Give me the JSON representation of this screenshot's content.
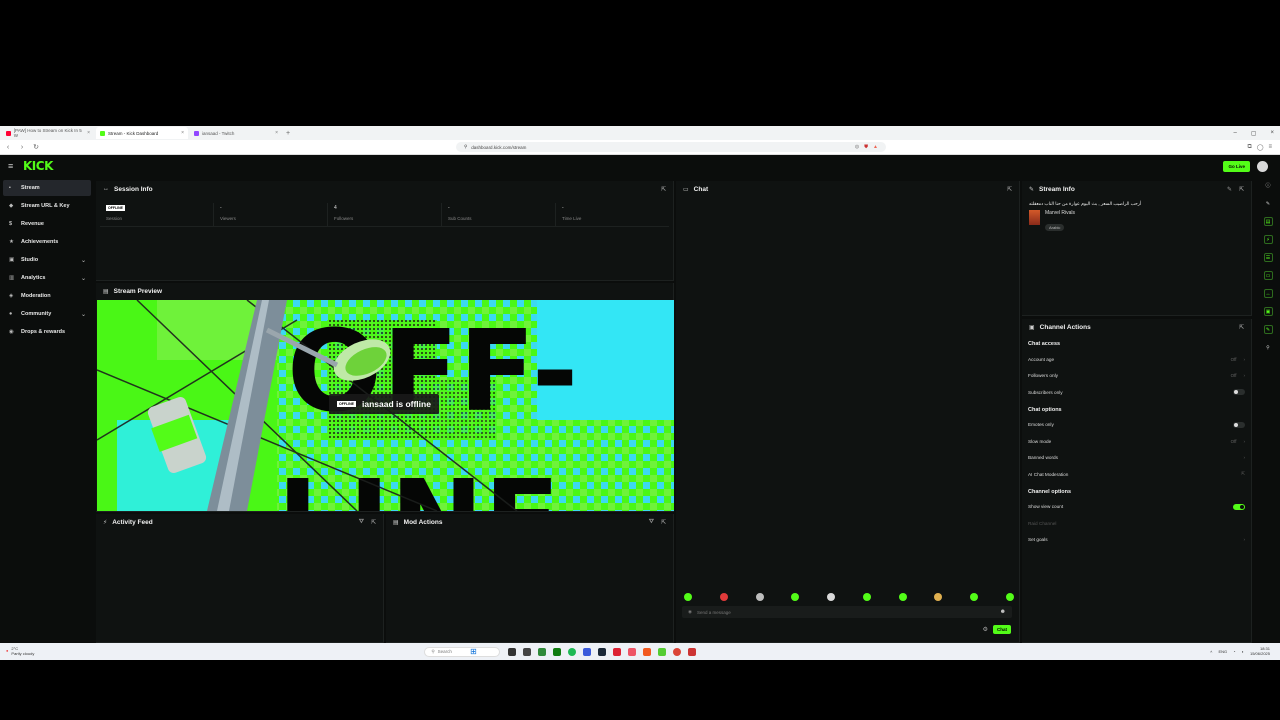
{
  "browser": {
    "tabs": [
      {
        "label": "[PAW] How to Stream on Kick In 5 W",
        "color": "#ff0033"
      },
      {
        "label": "Stream - Kick Dashboard",
        "color": "#53fc18",
        "active": true
      },
      {
        "label": "iansaad - Twitch",
        "color": "#9146ff"
      }
    ],
    "new_tab": "+",
    "url": "dashboard.kick.com/stream"
  },
  "app": {
    "logo": "KICK",
    "go_live": "Go Live"
  },
  "sidebar": {
    "items": [
      {
        "label": "Stream",
        "icon": "▪",
        "chevron": ""
      },
      {
        "label": "Stream URL & Key",
        "icon": "◆",
        "chevron": ""
      },
      {
        "label": "Revenue",
        "icon": "$",
        "chevron": ""
      },
      {
        "label": "Achievements",
        "icon": "★",
        "chevron": ""
      },
      {
        "label": "Studio",
        "icon": "▣",
        "chevron": "⌄"
      },
      {
        "label": "Analytics",
        "icon": "▥",
        "chevron": "⌄"
      },
      {
        "label": "Moderation",
        "icon": "◈",
        "chevron": ""
      },
      {
        "label": "Community",
        "icon": "●",
        "chevron": "⌄"
      },
      {
        "label": "Drops & rewards",
        "icon": "◉",
        "chevron": ""
      }
    ]
  },
  "session_info": {
    "title": "Session Info",
    "badge": "OFFLINE",
    "stats": [
      {
        "value": "",
        "label": "Session"
      },
      {
        "value": "-",
        "label": "Viewers"
      },
      {
        "value": "4",
        "label": "Followers"
      },
      {
        "value": "-",
        "label": "Sub Counts"
      },
      {
        "value": "-",
        "label": "Time Live"
      }
    ]
  },
  "stream_preview": {
    "title": "Stream Preview",
    "overlay_badge": "OFFLINE",
    "overlay_text": "iansaad is offline",
    "bg_text_top": "OFF-",
    "bg_text_bottom": "LINE"
  },
  "activity_feed": {
    "title": "Activity Feed"
  },
  "mod_actions": {
    "title": "Mod Actions"
  },
  "chat": {
    "title": "Chat",
    "placeholder": "Send a message",
    "send_label": "Chat",
    "emote_colors": [
      "#53fc18",
      "#e03a3a",
      "#bdbdbd",
      "#53fc18",
      "#d9d9d9",
      "#53fc18",
      "#53fc18",
      "#e0b050",
      "#53fc18",
      "#53fc18"
    ]
  },
  "stream_info": {
    "title": "Stream Info",
    "stream_title": "أرحب الراضيب السعر , بث اليوم عوارة من حنا الناب دمعقلته",
    "game": "Marvel Rivals",
    "tag": "Arabic"
  },
  "channel_actions": {
    "title": "Channel Actions",
    "sections": [
      {
        "heading": "Chat access",
        "rows": [
          {
            "label": "Account age",
            "value": "Off",
            "control": "chevron"
          },
          {
            "label": "Followers only",
            "value": "Off",
            "control": "chevron"
          },
          {
            "label": "Subscribers only",
            "value": "",
            "control": "toggle-off"
          }
        ]
      },
      {
        "heading": "Chat options",
        "rows": [
          {
            "label": "Emotes only",
            "value": "",
            "control": "toggle-off"
          },
          {
            "label": "Slow mode",
            "value": "Off",
            "control": "chevron"
          },
          {
            "label": "Banned words",
            "value": "",
            "control": "chevron"
          },
          {
            "label": "AI Chat Moderation",
            "value": "",
            "control": "external"
          }
        ]
      },
      {
        "heading": "Channel options",
        "rows": [
          {
            "label": "Show view count",
            "value": "",
            "control": "toggle-on"
          },
          {
            "label": "Raid Channel",
            "value": "",
            "control": "none",
            "dim": true
          },
          {
            "label": "Set goals",
            "value": "",
            "control": "chevron"
          }
        ]
      }
    ]
  },
  "taskbar": {
    "weather_temp": "2°C",
    "weather_desc": "Partly cloudy",
    "search": "Search",
    "lang": "ENG",
    "time": "18:31",
    "date": "15/06/2025"
  }
}
